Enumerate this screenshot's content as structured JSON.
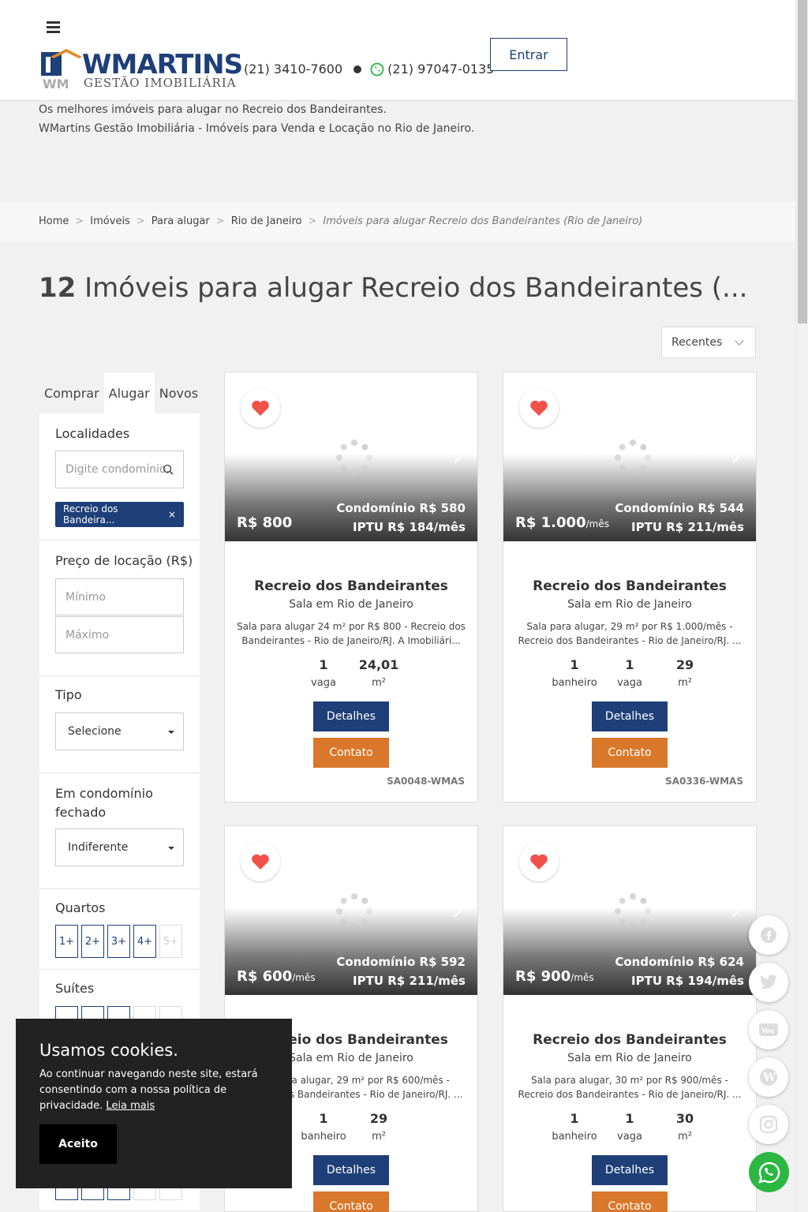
{
  "header": {
    "logo_text": "WMARTINS",
    "logo_sub": "GESTÃO IMOBILIÁRIA",
    "phone": "(21) 3410-7600",
    "whatsapp": "(21) 97047-0135",
    "login_label": "Entrar"
  },
  "intro": {
    "line1": "Os melhores imóveis para alugar no Recreio dos Bandeirantes.",
    "line2": "WMartins Gestão Imobiliária - Imóveis para Venda e Locação no Rio de Janeiro."
  },
  "breadcrumb": {
    "items": [
      "Home",
      "Imóveis",
      "Para alugar",
      "Rio de Janeiro"
    ],
    "current": "Imóveis para alugar Recreio dos Bandeirantes (Rio de Janeiro)"
  },
  "title": {
    "count": "12",
    "text": "Imóveis para alugar Recreio dos Bandeirantes (..."
  },
  "sort": {
    "selected": "Recentes"
  },
  "sidebar": {
    "tabs": [
      "Comprar",
      "Alugar",
      "Novos"
    ],
    "active_tab": "Alugar",
    "localidades_label": "Localidades",
    "localidades_placeholder": "Digite condomínio,",
    "tag": "Recreio dos Bandeira...",
    "preco_label": "Preço de locação (R$)",
    "min_placeholder": "Mínimo",
    "max_placeholder": "Máximo",
    "tipo_label": "Tipo",
    "tipo_value": "Selecione",
    "condominio_label": "Em condomínio fechado",
    "condominio_value": "Indiferente",
    "quartos_label": "Quartos",
    "quartos_options": [
      "1+",
      "2+",
      "3+",
      "4+",
      "5+"
    ],
    "suites_label": "Suítes"
  },
  "cards": [
    {
      "price": "R$ 800",
      "price_suffix": "",
      "condominio": "Condomínio R$ 580",
      "iptu": "IPTU R$ 184/mês",
      "title": "Recreio dos Bandeirantes",
      "subtitle": "Sala em Rio de Janeiro",
      "desc": "Sala para alugar 24 m² por R$ 800 - Recreio dos Bandeirantes - Rio de Janeiro/RJ. A Imobiliári...",
      "stats": [
        {
          "v": "1",
          "l": "vaga"
        },
        {
          "v": "24,01",
          "l": "m²"
        }
      ],
      "details": "Detalhes",
      "contact": "Contato",
      "code": "SA0048-WMAS"
    },
    {
      "price": "R$ 1.000",
      "price_suffix": "/mês",
      "condominio": "Condomínio R$ 544",
      "iptu": "IPTU R$ 211/mês",
      "title": "Recreio dos Bandeirantes",
      "subtitle": "Sala em Rio de Janeiro",
      "desc": "Sala para alugar, 29 m² por R$ 1.000/mês - Recreio dos Bandeirantes - Rio de Janeiro/RJ. ...",
      "stats": [
        {
          "v": "1",
          "l": "banheiro"
        },
        {
          "v": "1",
          "l": "vaga"
        },
        {
          "v": "29",
          "l": "m²"
        }
      ],
      "details": "Detalhes",
      "contact": "Contato",
      "code": "SA0336-WMAS"
    },
    {
      "price": "R$ 600",
      "price_suffix": "/mês",
      "condominio": "Condomínio R$ 592",
      "iptu": "IPTU R$ 211/mês",
      "title": "Recreio dos Bandeirantes",
      "subtitle": "Sala em Rio de Janeiro",
      "desc": "Sala para alugar, 29 m² por R$ 600/mês - Recreio dos Bandeirantes - Rio de Janeiro/RJ. ...",
      "stats": [
        {
          "v": "1",
          "l": "banheiro"
        },
        {
          "v": "29",
          "l": "m²"
        }
      ],
      "details": "Detalhes",
      "contact": "Contato",
      "code": ""
    },
    {
      "price": "R$ 900",
      "price_suffix": "/mês",
      "condominio": "Condomínio R$ 624",
      "iptu": "IPTU R$ 194/mês",
      "title": "Recreio dos Bandeirantes",
      "subtitle": "Sala em Rio de Janeiro",
      "desc": "Sala para alugar, 30 m² por R$ 900/mês - Recreio dos Bandeirantes - Rio de Janeiro/RJ. ...",
      "stats": [
        {
          "v": "1",
          "l": "banheiro"
        },
        {
          "v": "1",
          "l": "vaga"
        },
        {
          "v": "30",
          "l": "m²"
        }
      ],
      "details": "Detalhes",
      "contact": "Contato",
      "code": ""
    }
  ],
  "cookie": {
    "title": "Usamos cookies.",
    "text": "Ao continuar navegando neste site, estará consentindo com a nossa política de privacidade.",
    "link": "Leia mais",
    "accept": "Aceito"
  },
  "social": [
    "facebook-icon",
    "twitter-icon",
    "youtube-icon",
    "wordpress-icon",
    "instagram-icon"
  ],
  "colors": {
    "brand_blue": "#1e3f78",
    "accent_orange": "#d9782a",
    "whatsapp_green": "#2bb741",
    "heart_red": "#f0524a"
  }
}
